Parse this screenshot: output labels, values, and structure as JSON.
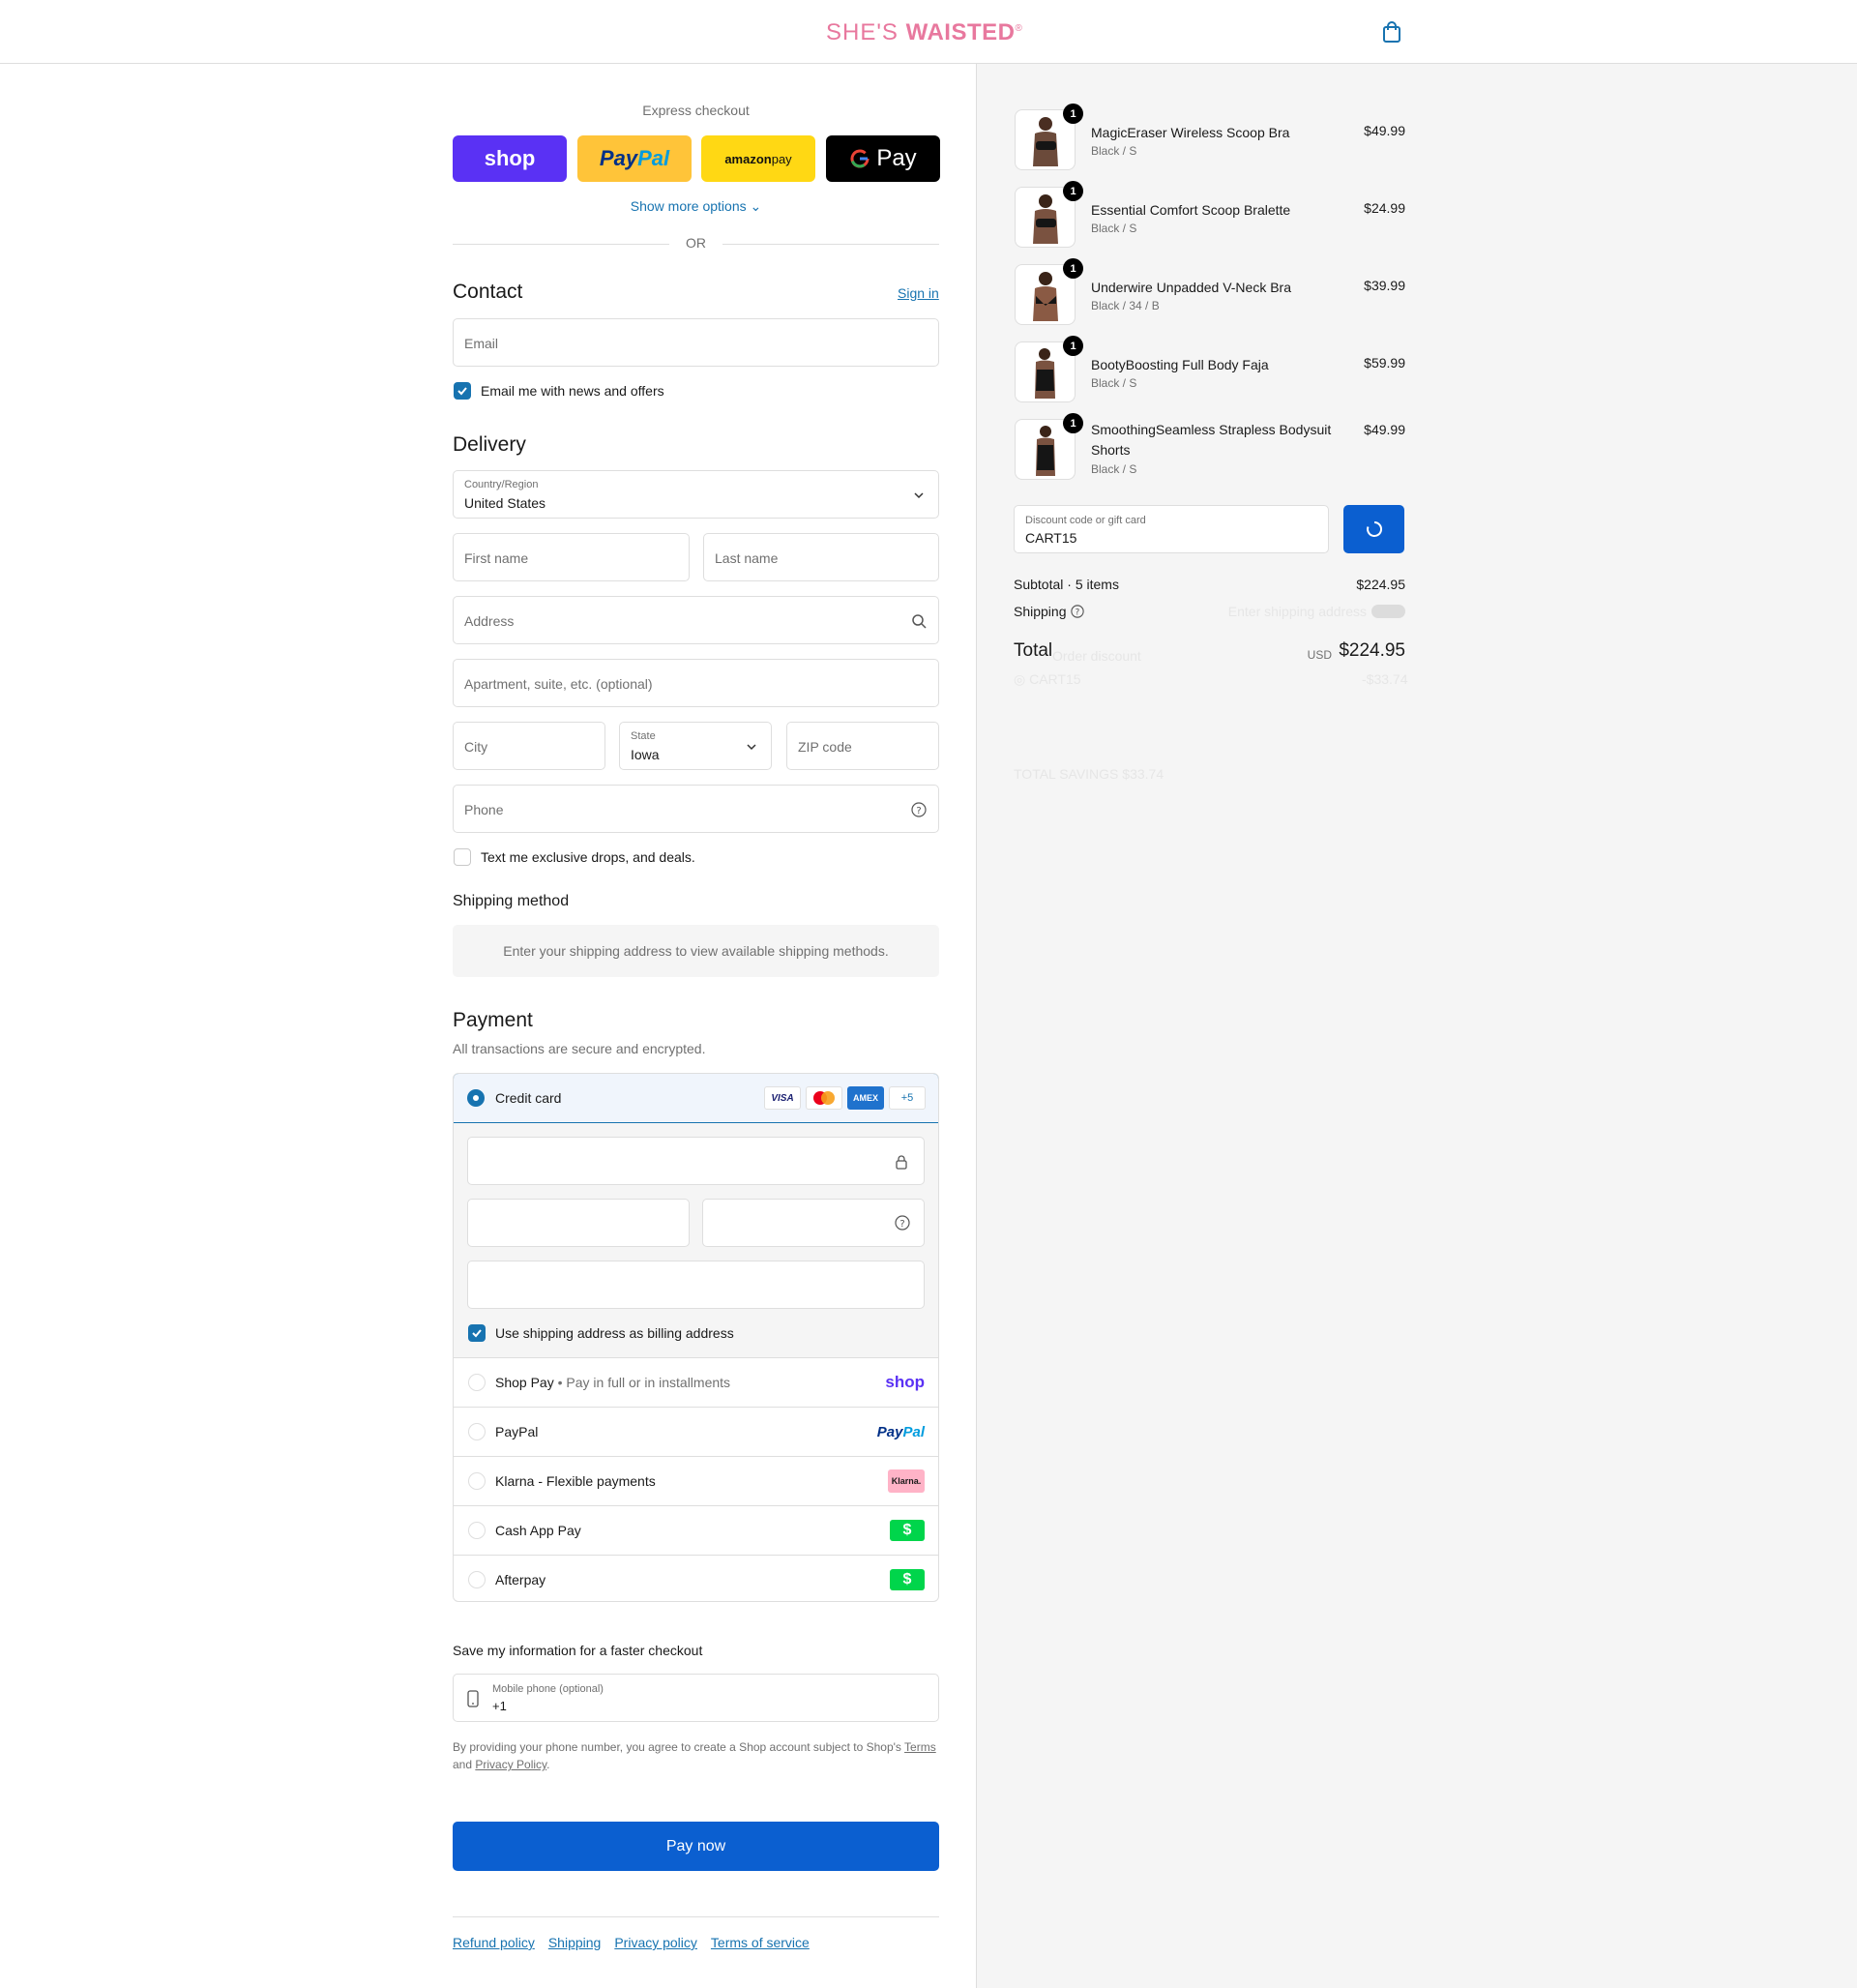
{
  "header": {
    "brand_light": "SHE'S ",
    "brand_bold": "WAISTED",
    "brand_mark": "®"
  },
  "express": {
    "title": "Express checkout",
    "shop_label": "shop",
    "paypal_a": "Pay",
    "paypal_b": "Pal",
    "amazon_a": "amazon",
    "amazon_b": " pay",
    "gpay_label": "Pay",
    "show_more": "Show more options",
    "or": "OR"
  },
  "contact": {
    "title": "Contact",
    "sign_in": "Sign in",
    "email_placeholder": "Email",
    "newsletter_label": "Email me with news and offers",
    "newsletter_checked": true
  },
  "delivery": {
    "title": "Delivery",
    "country_label": "Country/Region",
    "country_value": "United States",
    "first_name": "First name",
    "last_name": "Last name",
    "address": "Address",
    "apartment": "Apartment, suite, etc. (optional)",
    "city": "City",
    "state_label": "State",
    "state_value": "Iowa",
    "zip": "ZIP code",
    "phone": "Phone",
    "sms_label": "Text me exclusive drops, and deals.",
    "sms_checked": false
  },
  "shipping_method": {
    "title": "Shipping method",
    "message": "Enter your shipping address to view available shipping methods."
  },
  "payment": {
    "title": "Payment",
    "subtitle": "All transactions are secure and encrypted.",
    "credit_card": "Credit card",
    "card_logos": [
      "VISA",
      "AMEX",
      "+5"
    ],
    "billing_label": "Use shipping address as billing address",
    "options": [
      {
        "name": "Shop Pay",
        "sub": "Pay in full or in installments",
        "logo": "shop"
      },
      {
        "name": "PayPal",
        "logo_a": "Pay",
        "logo_b": "Pal"
      },
      {
        "name": "Klarna - Flexible payments",
        "logo": "Klarna."
      },
      {
        "name": "Cash App Pay",
        "logo": "$"
      },
      {
        "name": "Afterpay",
        "logo": "$"
      }
    ]
  },
  "remember": {
    "title": "Save my information for a faster checkout",
    "mobile_label": "Mobile phone (optional)",
    "mobile_value": "+1",
    "legal_pre": "By providing your phone number, you agree to create a Shop account subject to Shop's ",
    "terms": "Terms",
    "legal_and": "and ",
    "privacy": "Privacy Policy",
    "legal_end": "."
  },
  "pay_now": "Pay now",
  "footer": [
    "Refund policy",
    "Shipping",
    "Privacy policy",
    "Terms of service"
  ],
  "summary": {
    "items": [
      {
        "name": "MagicEraser Wireless Scoop Bra",
        "variant": "Black / S",
        "price": "$49.99",
        "qty": "1"
      },
      {
        "name": "Essential Comfort Scoop Bralette",
        "variant": "Black / S",
        "price": "$24.99",
        "qty": "1"
      },
      {
        "name": "Underwire Unpadded V-Neck Bra",
        "variant": "Black / 34 / B",
        "price": "$39.99",
        "qty": "1"
      },
      {
        "name": "BootyBoosting Full Body Faja",
        "variant": "Black / S",
        "price": "$59.99",
        "qty": "1"
      },
      {
        "name": "SmoothingSeamless Strapless Bodysuit Shorts",
        "variant": "Black / S",
        "price": "$49.99",
        "qty": "1"
      }
    ],
    "discount_label": "Discount code or gift card",
    "discount_value": "CART15",
    "subtotal_label": "Subtotal · 5 items",
    "subtotal_value": "$224.95",
    "shipping_label": "Shipping",
    "total_label": "Total",
    "currency": "USD",
    "total_value": "$224.95",
    "ghost_shipping": "Enter shipping address",
    "ghost_discount": "Order discount",
    "ghost_code": "CART15",
    "ghost_code_value": "-$33.74",
    "ghost_savings": "TOTAL SAVINGS  $33.74"
  }
}
